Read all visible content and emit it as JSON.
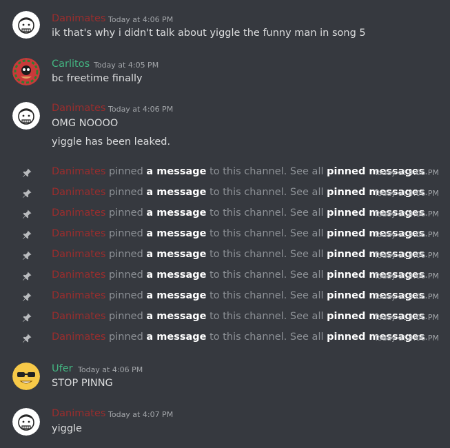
{
  "colors": {
    "background": "#36393f",
    "danimates": "#9b2d2d",
    "carlitos": "#43b581",
    "ufer": "#43b581"
  },
  "messages": [
    {
      "author": "Danimates",
      "timestamp": "Today at 4:06 PM",
      "lines": [
        "ik that's why i didn't talk about yiggle the funny man in song 5"
      ],
      "avatar": "danimates-avatar"
    },
    {
      "author": "Carlitos",
      "timestamp": "Today at 4:05 PM",
      "lines": [
        "bc freetime finally"
      ],
      "avatar": "carlitos-avatar"
    },
    {
      "author": "Danimates",
      "timestamp": "Today at 4:06 PM",
      "lines": [
        "OMG NOOOO",
        "yiggle has been leaked."
      ],
      "avatar": "danimates-avatar"
    }
  ],
  "pins": {
    "who": "Danimates",
    "pinned": " pinned ",
    "a_message": "a message",
    "middle": " to this channel. See all ",
    "pinned_messages": "pinned messages",
    "end": ".",
    "timestamp": "Today at 4:06 PM",
    "count": 9,
    "icon": "pin-icon"
  },
  "messages_after": [
    {
      "author": "Ufer",
      "timestamp": "Today at 4:06 PM",
      "lines": [
        "STOP PINNG"
      ],
      "avatar": "ufer-avatar"
    },
    {
      "author": "Danimates",
      "timestamp": "Today at 4:07 PM",
      "lines": [
        "yiggle"
      ],
      "avatar": "danimates-avatar"
    }
  ]
}
